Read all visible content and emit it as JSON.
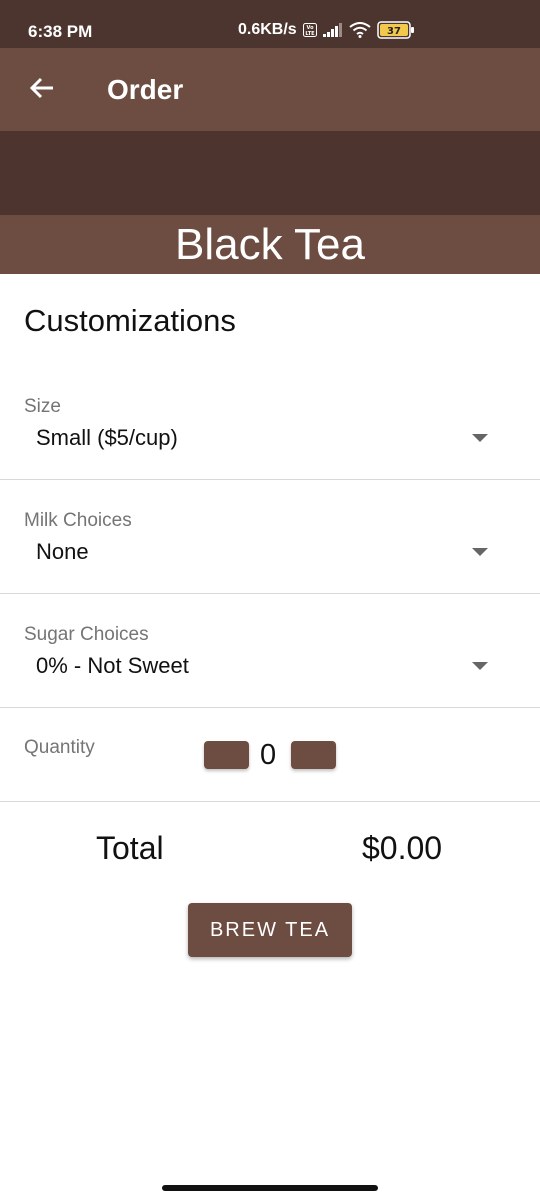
{
  "status_bar": {
    "time": "6:38 PM",
    "network_speed": "0.6KB/s",
    "volte_label": "Vo LTE",
    "battery_level": "37",
    "icons": [
      "volte-icon",
      "signal-icon",
      "wifi-icon",
      "battery-icon"
    ]
  },
  "app_bar": {
    "title": "Order",
    "back_icon": "back-arrow-icon"
  },
  "hero": {
    "title": "Black Tea"
  },
  "customizations": {
    "title": "Customizations",
    "fields": [
      {
        "label": "Size",
        "value": "Small ($5/cup)"
      },
      {
        "label": "Milk Choices",
        "value": "None"
      },
      {
        "label": "Sugar Choices",
        "value": "0% - Not Sweet"
      }
    ]
  },
  "quantity": {
    "label": "Quantity",
    "value": "0"
  },
  "total": {
    "label": "Total",
    "value": "$0.00"
  },
  "brew_button": {
    "label": "BREW TEA"
  },
  "colors": {
    "status_bar": "#4d352f",
    "app_bar": "#6d4c41",
    "hero_band": "#4d342f",
    "accent": "#6d4c41",
    "battery_fill": "#f2c94c"
  }
}
